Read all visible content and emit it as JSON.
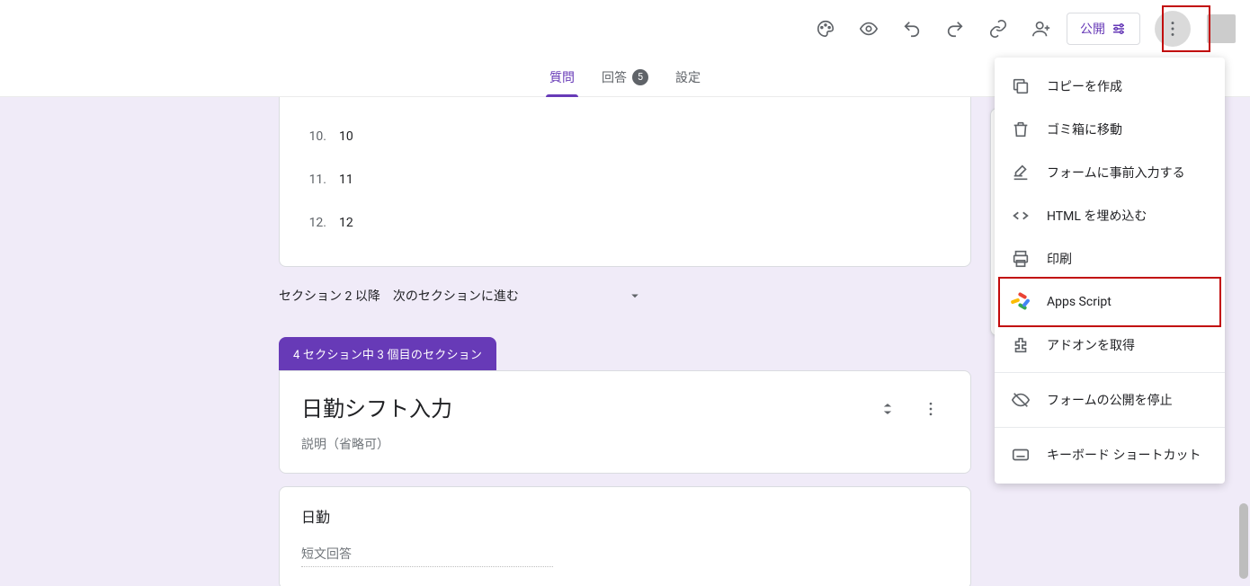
{
  "header": {
    "publish_label": "公開",
    "icons": {
      "palette": "palette-icon",
      "preview": "eye-icon",
      "undo": "undo-icon",
      "redo": "redo-icon",
      "link": "link-icon",
      "share": "person-add-icon",
      "more": "more-vert-icon"
    }
  },
  "tabs": {
    "questions": "質問",
    "responses": "回答",
    "responses_count": "5",
    "settings": "設定"
  },
  "options": [
    {
      "num": "10.",
      "txt": "10"
    },
    {
      "num": "11.",
      "txt": "11"
    },
    {
      "num": "12.",
      "txt": "12"
    }
  ],
  "section_nav": {
    "label": "セクション 2 以降",
    "select": "次のセクションに進む"
  },
  "section3": {
    "chip": "4 セクション中 3 個目のセクション",
    "title": "日勤シフト入力",
    "desc_placeholder": "説明（省略可）"
  },
  "question": {
    "title": "日勤",
    "short_answer": "短文回答"
  },
  "menu": {
    "copy": "コピーを作成",
    "trash": "ゴミ箱に移動",
    "prefill": "フォームに事前入力する",
    "embed": "HTML を埋め込む",
    "print": "印刷",
    "apps_script": "Apps Script",
    "addons": "アドオンを取得",
    "stop_publish": "フォームの公開を停止",
    "shortcuts": "キーボード ショートカット"
  },
  "side_toolbar": {
    "add_question": "add-circle-icon",
    "import": "import-icon",
    "title": "text-icon",
    "image": "image-icon",
    "video": "video-icon",
    "section": "section-icon"
  }
}
